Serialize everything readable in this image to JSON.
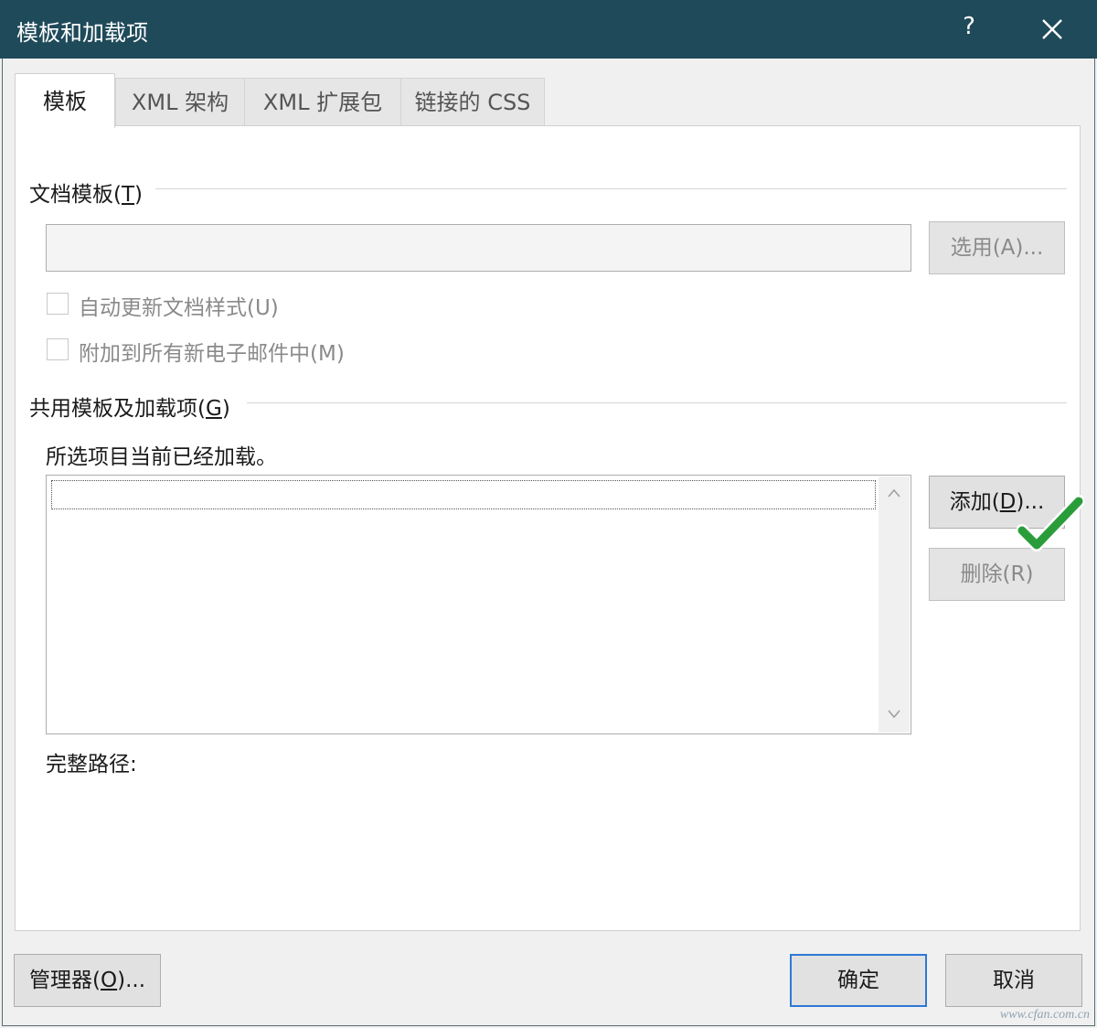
{
  "window": {
    "title": "模板和加载项",
    "help_label": "?",
    "close_icon": "close-icon"
  },
  "tabs": [
    {
      "label": "模板",
      "active": true
    },
    {
      "label": "XML 架构",
      "active": false
    },
    {
      "label": "XML 扩展包",
      "active": false
    },
    {
      "label": "链接的 CSS",
      "active": false
    }
  ],
  "doc_template": {
    "group_label": "文档模板(",
    "group_key": "T",
    "group_suffix": ")",
    "path_value": "",
    "attach_label": "选用(A)...",
    "auto_update_label": "自动更新文档样式(U)",
    "auto_update_checked": false,
    "attach_email_label": "附加到所有新电子邮件中(M)",
    "attach_email_checked": false
  },
  "global_templates": {
    "group_label": "共用模板及加载项(",
    "group_key": "G",
    "group_suffix": ")",
    "note": "所选项目当前已经加载。",
    "items": [],
    "add_label_prefix": "添加(",
    "add_key": "D",
    "add_label_suffix": ")...",
    "remove_label": "删除(R)",
    "full_path_label": "完整路径:"
  },
  "footer": {
    "organizer_prefix": "管理器(",
    "organizer_key": "O",
    "organizer_suffix": ")...",
    "ok_label": "确定",
    "cancel_label": "取消"
  },
  "annotation": {
    "checkmark_color": "#2a9d3a",
    "checkmark_icon": "checkmark-icon"
  },
  "watermark": "www.cfan.com.cn"
}
